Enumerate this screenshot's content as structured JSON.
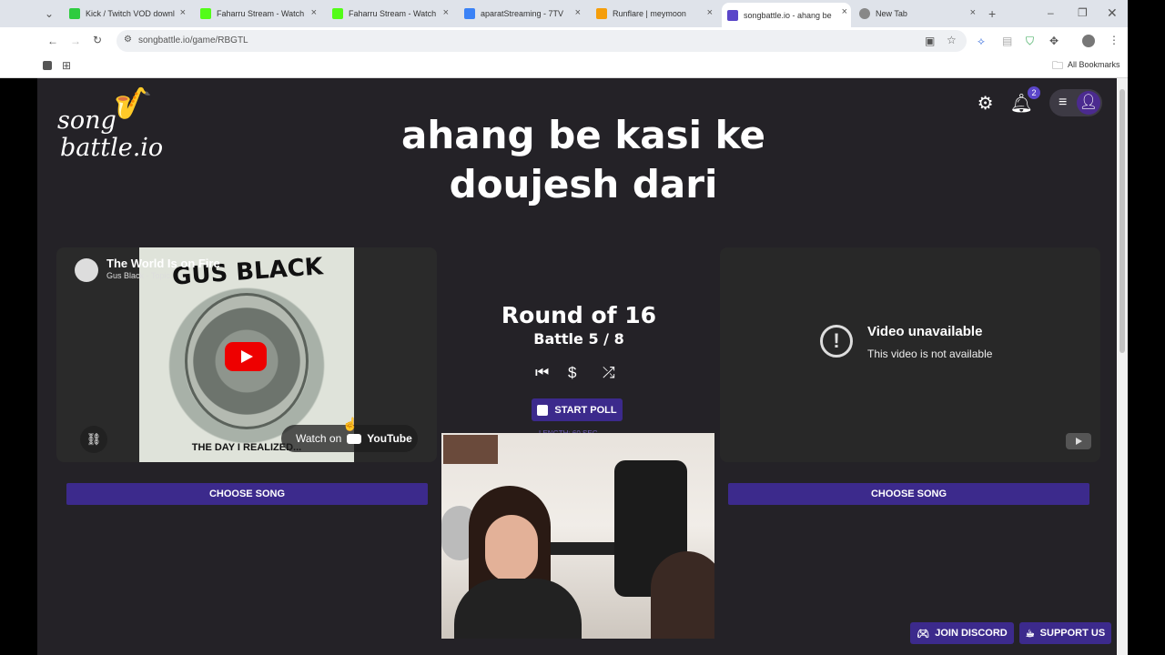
{
  "browser": {
    "tabs": [
      {
        "title": "Kick / Twitch VOD downl",
        "color": "#2ecc40"
      },
      {
        "title": "Faharru Stream - Watch",
        "color": "#53fc18"
      },
      {
        "title": "Faharru Stream - Watch",
        "color": "#53fc18"
      },
      {
        "title": "aparatStreaming - 7TV",
        "color": "#3b82f6"
      },
      {
        "title": "Runflare | meymoon",
        "color": "#f59e0b"
      },
      {
        "title": "songbattle.io - ahang be",
        "color": "#5b46c9"
      },
      {
        "title": "New Tab",
        "color": "#888888"
      }
    ],
    "url": "songbattle.io/game/RBGTL",
    "bookmarks_label": "All Bookmarks"
  },
  "site": {
    "logo_line1": "song",
    "logo_line2": "battle.io",
    "title_line1": "ahang be kasi ke",
    "title_line2": "doujesh dari",
    "notification_count": "2"
  },
  "left_video": {
    "title": "The World Is on Fire",
    "channel": "Gus Black - Topic",
    "cover_text_top": "GUS BLACK",
    "cover_text_bottom": "THE DAY I REALIZED...",
    "watch_on": "Watch on",
    "youtube": "YouTube"
  },
  "battle": {
    "round": "Round of 16",
    "battle": "Battle 5 / 8",
    "poll_label": "START POLL",
    "length_label": "LENGTH: 60 SEC"
  },
  "right_video": {
    "title": "Video unavailable",
    "subtitle": "This video is not available"
  },
  "buttons": {
    "choose_left": "CHOOSE SONG",
    "choose_right": "CHOOSE SONG",
    "discord": "JOIN DISCORD",
    "support": "SUPPORT US"
  },
  "colors": {
    "page_bg": "#242227",
    "accent": "#3c2a8c"
  }
}
